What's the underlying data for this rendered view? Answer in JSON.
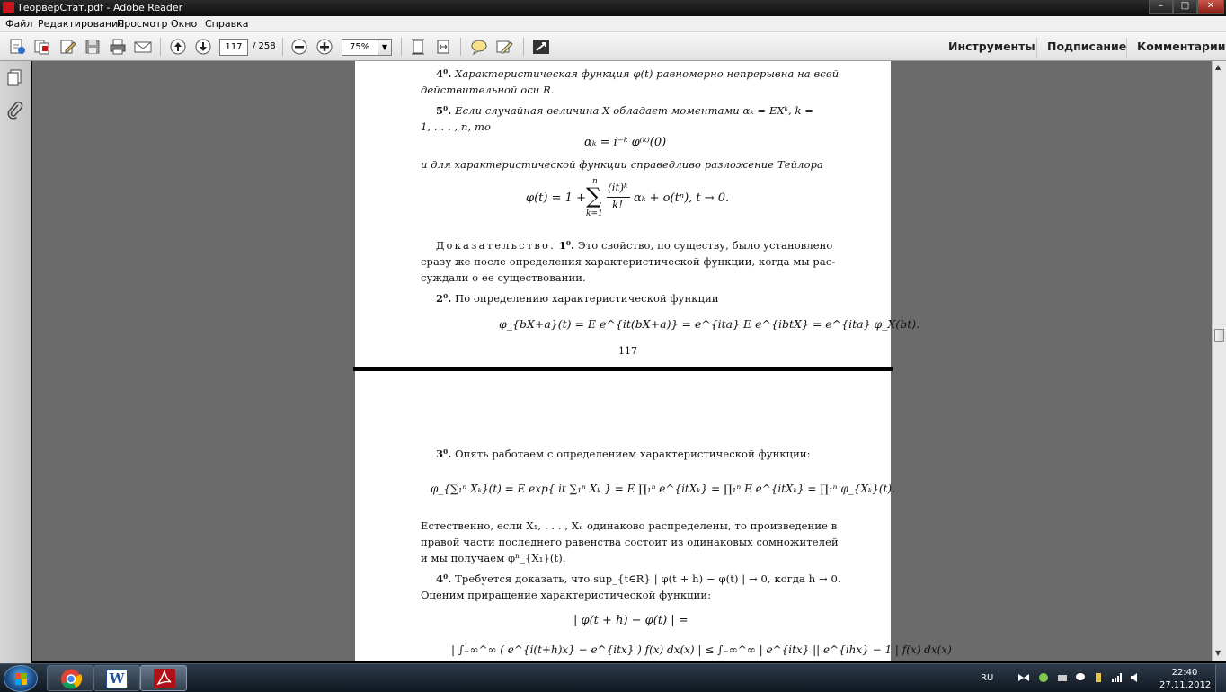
{
  "window": {
    "title": "ТеорверСтат.pdf - Adobe Reader",
    "minimize": "–",
    "maximize": "□",
    "close": "✕"
  },
  "menu": [
    "Файл",
    "Редактирование",
    "Просмотр",
    "Окно",
    "Справка"
  ],
  "toolbar": {
    "current_page": "117",
    "total_pages": "/ 258",
    "zoom": "75%",
    "zoom_dropdown": "▼",
    "right_tabs": [
      "Инструменты",
      "Подписание",
      "Комментарии"
    ]
  },
  "left_panel": {
    "icons": [
      "pages-icon",
      "attachment-icon"
    ]
  },
  "scrollbar": {
    "up": "▲",
    "down": "▼"
  },
  "page1": {
    "item4_num": "4⁰.",
    "item4_text": "Характеристическая функция φ(t) равномерно непрерывна на всей",
    "item4_text2": "действительной оси R.",
    "item5_num": "5⁰.",
    "item5_text": "Если случайная величина X обладает моментами αₖ = EXᵏ, k =",
    "item5_text2": "1, . . . , n, то",
    "eq_alpha": "αₖ = i⁻ᵏ φ⁽ᵏ⁾(0)",
    "taylor_intro": "и для характеристической функции справедливо разложение Тейлора",
    "eq_taylor_left": "φ(t) = 1 +",
    "eq_taylor_sum": "∑",
    "eq_taylor_top": "n",
    "eq_taylor_bot": "k=1",
    "eq_taylor_num": "(it)ᵏ",
    "eq_taylor_den": "k!",
    "eq_taylor_right": "αₖ + o(tⁿ),  t → 0.",
    "proof_word": "Доказательство.",
    "proof_num": "1⁰.",
    "proof_text1": "Это свойство, по существу, было установлено",
    "proof_text2": "сразу же после определения характеристической функции, когда мы рас-",
    "proof_text3": "суждали о ее существовании.",
    "item2_num": "2⁰.",
    "item2_text": "По определению характеристической функции",
    "eq_bxa": "φ_{bX+a}(t) = E e^{it(bX+a)} = e^{ita} E e^{ibtX} = e^{ita} φ_X(bt).",
    "page_number": "117"
  },
  "page2": {
    "item3_num": "3⁰.",
    "item3_text": "Опять работаем с определением характеристической функции:",
    "eq_sum": "φ_{∑₁ⁿ Xₖ}(t) = E exp{ it ∑₁ⁿ Xₖ } = E ∏₁ⁿ e^{itXₖ} = ∏₁ⁿ E e^{itXₖ} = ∏₁ⁿ φ_{Xₖ}(t).",
    "nat_text1": "Естественно, если X₁, . . . , Xₙ одинаково распределены, то произведение в",
    "nat_text2": "правой части последнего равенства состоит из одинаковых сомножителей",
    "nat_text3": "и мы получаем φⁿ_{X₁}(t).",
    "item4_num": "4⁰.",
    "item4_text": "Требуется доказать, что sup_{t∈R} | φ(t + h) − φ(t) | → 0, когда h → 0.",
    "item4_text2": "Оценим приращение характеристической функции:",
    "eq_incr": "| φ(t + h) − φ(t) | =",
    "eq_integral_partial": "| ∫₋∞^∞ ( e^{i(t+h)x} − e^{itx} ) f(x) dx(x) |  ≤  ∫₋∞^∞ | e^{itx} || e^{ihx} − 1 | f(x) dx(x)"
  },
  "taskbar": {
    "lang": "RU",
    "time": "22:40",
    "date": "27.11.2012",
    "word_label": "W"
  }
}
